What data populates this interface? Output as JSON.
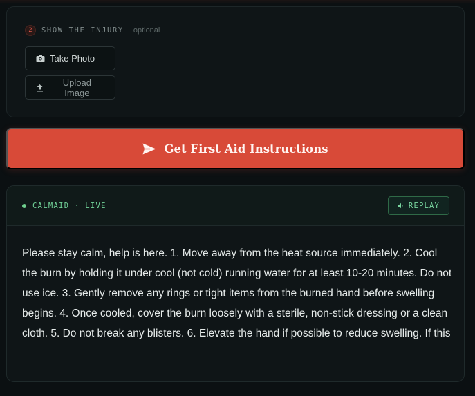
{
  "upload": {
    "step_number": "2",
    "step_title": "SHOW THE INJURY",
    "optional_label": "optional",
    "take_photo_label": "Take Photo",
    "upload_image_label": "Upload Image",
    "icons": {
      "take_photo": "camera-icon",
      "upload_image": "upload-arrow-icon"
    }
  },
  "cta": {
    "label": "Get First Aid Instructions",
    "icon": "send-icon"
  },
  "response": {
    "source_label": "CALMAID · LIVE",
    "replay_label": "REPLAY",
    "replay_icon": "speaker-icon",
    "text": "Please stay calm, help is here. 1. Move away from the heat source immediately. 2. Cool the burn by holding it under cool (not cold) running water for at least 10-20 minutes. Do not use ice. 3. Gently remove any rings or tight items from the burned hand before swelling begins. 4. Once cooled, cover the burn loosely with a sterile, non-stick dressing or a clean cloth. 5. Do not break any blisters. 6. Elevate the hand if possible to reduce swelling. If this"
  },
  "colors": {
    "background": "#0b1012",
    "accent_red": "#d84a38",
    "live_green": "#72d399",
    "text": "#e6ebea"
  }
}
